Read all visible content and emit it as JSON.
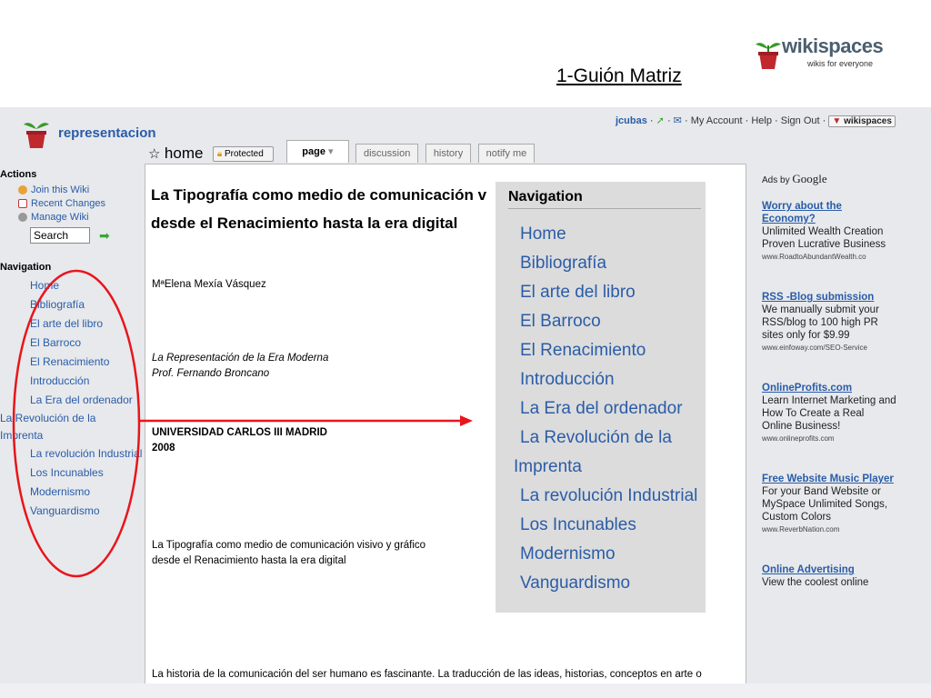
{
  "slide": {
    "title": "1-Guión Matriz",
    "brand": {
      "name": "wikispaces",
      "tagline": "wikis for everyone"
    }
  },
  "wiki": {
    "site_name": "representacion",
    "topbar": {
      "user": "jcubas",
      "links": [
        "My Account",
        "Help",
        "Sign Out"
      ],
      "logo_label": "wikispaces"
    },
    "page_name": "home",
    "protected_label": "Protected",
    "tabs": [
      "page",
      "discussion",
      "history",
      "notify me"
    ],
    "actions_heading": "Actions",
    "actions": [
      {
        "label": "Join this Wiki",
        "icon": "join-icon"
      },
      {
        "label": "Recent Changes",
        "icon": "calendar-icon"
      },
      {
        "label": "Manage Wiki",
        "icon": "gear-icon"
      }
    ],
    "search_value": "Search",
    "navigation_heading": "Navigation",
    "navigation": [
      "Home",
      "Bibliografía",
      "El arte del libro",
      "El Barroco",
      "El Renacimiento",
      "Introducción",
      "La Era del ordenador",
      "La Revolución de la Imprenta",
      "La revolución Industrial",
      "Los Incunables",
      "Modernismo",
      "Vanguardismo"
    ]
  },
  "content": {
    "title_line1": "La Tipografía como medio de comunicación v",
    "title_line2": "desde el Renacimiento hasta la era digital",
    "author": "MªElena Mexía Vásquez",
    "course": "La Representación de la Era Moderna",
    "professor": "Prof. Fernando Broncano",
    "university": "UNIVERSIDAD CARLOS III MADRID",
    "year": "2008",
    "subtitle_line1": "La Tipografía como medio de comunicación visivo y gráfico",
    "subtitle_line2": "desde el Renacimiento hasta la era digital",
    "body": "La historia de la comunicación del ser humano es fascinante. La traducción de las ideas, historias, conceptos en arte o"
  },
  "ads": {
    "ads_by": "Ads by",
    "google": "Google",
    "items": [
      {
        "title": "Worry about the Economy?",
        "text": "Unlimited Wealth Creation Proven Lucrative Business",
        "url": "www.RoadtoAbundantWealth.co"
      },
      {
        "title": "RSS -Blog submission",
        "text": "We manually submit your RSS/blog to 100 high PR sites only for $9.99",
        "url": "www.einfoway.com/SEO-Service"
      },
      {
        "title": "OnlineProfits.com",
        "text": "Learn Internet Marketing and How To Create a Real Online Business!",
        "url": "www.onlineprofits.com"
      },
      {
        "title": "Free Website Music Player",
        "text": "For your Band Website or MySpace Unlimited Songs, Custom Colors",
        "url": "www.ReverbNation.com"
      },
      {
        "title": "Online Advertising",
        "text": "View the coolest online",
        "url": ""
      }
    ]
  },
  "zoom": {
    "heading": "Navigation",
    "items": [
      "Home",
      "Bibliografía",
      "El arte del libro",
      "El Barroco",
      "El Renacimiento",
      "Introducción",
      "La Era del ordenador",
      "La Revolución de la",
      "Imprenta",
      "La revolución Industrial",
      "Los Incunables",
      "Modernismo",
      "Vanguardismo"
    ]
  },
  "colors": {
    "link": "#2a5ca8",
    "annotation": "#e8151b"
  }
}
